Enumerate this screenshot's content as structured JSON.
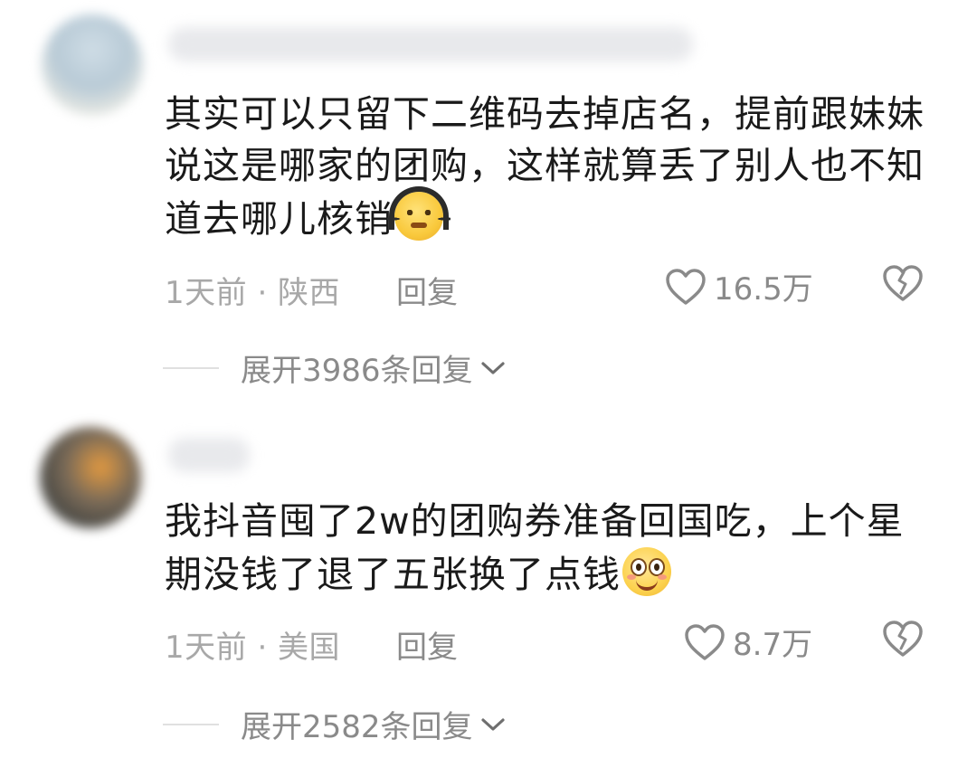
{
  "comments": [
    {
      "text": "其实可以只留下二维码去掉店名，提前跟妹妹说这是哪家的团购，这样就算丢了别人也不知道去哪儿核销",
      "emoji": "headphones-face-emoji",
      "time_location": "1天前 · 陕西",
      "reply_label": "回复",
      "likes": "16.5万",
      "expand_label": "展开3986条回复"
    },
    {
      "text": "我抖音囤了2w的团购券准备回国吃，上个星期没钱了退了五张换了点钱",
      "emoji": "smiling-face-emoji",
      "time_location": "1天前 · 美国",
      "reply_label": "回复",
      "likes": "8.7万",
      "expand_label": "展开2582条回复"
    }
  ],
  "icons": {
    "like": "heart-outline-icon",
    "dislike": "broken-heart-icon",
    "expand": "chevron-down-icon"
  },
  "colors": {
    "text": "#1a1a1a",
    "meta": "#a8a8a8",
    "action": "#8a8a8a"
  }
}
